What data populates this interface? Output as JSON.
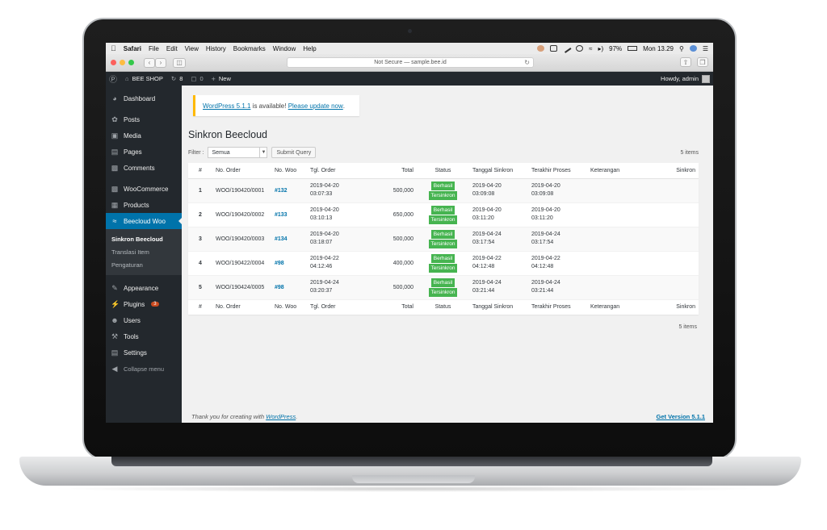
{
  "menubar": {
    "apple": "",
    "items": [
      "Safari",
      "File",
      "Edit",
      "View",
      "History",
      "Bookmarks",
      "Window",
      "Help"
    ],
    "battery": "97%",
    "clock": "Mon 13.29"
  },
  "browser": {
    "url": "Not Secure — sample.bee.id"
  },
  "adminbar": {
    "site": "BEE SHOP",
    "updates": "8",
    "comments": "0",
    "new_label": "New",
    "howdy": "Howdy, admin"
  },
  "sidebar": {
    "items": [
      {
        "label": "Dashboard",
        "icon": "dashboard-icon"
      },
      {
        "label": "Posts",
        "icon": "pin-icon"
      },
      {
        "label": "Media",
        "icon": "media-icon"
      },
      {
        "label": "Pages",
        "icon": "pages-icon"
      },
      {
        "label": "Comments",
        "icon": "comment-icon"
      },
      {
        "label": "WooCommerce",
        "icon": "woocommerce-icon"
      },
      {
        "label": "Products",
        "icon": "archive-icon"
      },
      {
        "label": "Beecloud Woo",
        "icon": "wifi-icon"
      },
      {
        "label": "Appearance",
        "icon": "brush-icon"
      },
      {
        "label": "Plugins",
        "icon": "plugin-icon",
        "badge": "3"
      },
      {
        "label": "Users",
        "icon": "users-icon"
      },
      {
        "label": "Tools",
        "icon": "wrench-icon"
      },
      {
        "label": "Settings",
        "icon": "settings-icon"
      }
    ],
    "submenu": [
      "Sinkron Beecloud",
      "Translasi Item",
      "Pengaturan"
    ],
    "collapse": "Collapse menu"
  },
  "notice": {
    "link": "WordPress 5.1.1",
    "text": " is available! ",
    "action": "Please update now",
    "period": "."
  },
  "page": {
    "title": "Sinkron Beecloud",
    "filter_label": "Filter :",
    "filter_value": "Semua",
    "submit": "Submit Query",
    "items_count": "5 items"
  },
  "table": {
    "headers": [
      "#",
      "No. Order",
      "No. Woo",
      "Tgl. Order",
      "Total",
      "Status",
      "Tanggal Sinkron",
      "Terakhir Proses",
      "Keterangan",
      "Sinkron"
    ],
    "rows": [
      {
        "num": "1",
        "order": "WOO/190420/0001",
        "woo": "#132",
        "tgl_d": "2019-04-20",
        "tgl_t": "03:07:33",
        "total": "500,000",
        "status1": "Berhasil",
        "status2": "Tersinkron",
        "sync_d": "2019-04-20",
        "sync_t": "03:09:08",
        "last_d": "2019-04-20",
        "last_t": "03:09:08",
        "note": "",
        "sinkron": ""
      },
      {
        "num": "2",
        "order": "WOO/190420/0002",
        "woo": "#133",
        "tgl_d": "2019-04-20",
        "tgl_t": "03:10:13",
        "total": "650,000",
        "status1": "Berhasil",
        "status2": "Tersinkron",
        "sync_d": "2019-04-20",
        "sync_t": "03:11:20",
        "last_d": "2019-04-20",
        "last_t": "03:11:20",
        "note": "",
        "sinkron": ""
      },
      {
        "num": "3",
        "order": "WOO/190420/0003",
        "woo": "#134",
        "tgl_d": "2019-04-20",
        "tgl_t": "03:18:07",
        "total": "500,000",
        "status1": "Berhasil",
        "status2": "Tersinkron",
        "sync_d": "2019-04-24",
        "sync_t": "03:17:54",
        "last_d": "2019-04-24",
        "last_t": "03:17:54",
        "note": "",
        "sinkron": ""
      },
      {
        "num": "4",
        "order": "WOO/190422/0004",
        "woo": "#98",
        "tgl_d": "2019-04-22",
        "tgl_t": "04:12:46",
        "total": "400,000",
        "status1": "Berhasil",
        "status2": "Tersinkron",
        "sync_d": "2019-04-22",
        "sync_t": "04:12:48",
        "last_d": "2019-04-22",
        "last_t": "04:12:48",
        "note": "",
        "sinkron": ""
      },
      {
        "num": "5",
        "order": "WOO/190424/0005",
        "woo": "#98",
        "tgl_d": "2019-04-24",
        "tgl_t": "03:20:37",
        "total": "500,000",
        "status1": "Berhasil",
        "status2": "Tersinkron",
        "sync_d": "2019-04-24",
        "sync_t": "03:21:44",
        "last_d": "2019-04-24",
        "last_t": "03:21:44",
        "note": "",
        "sinkron": ""
      }
    ]
  },
  "footer": {
    "text": "Thank you for creating with ",
    "link": "WordPress",
    "period": ".",
    "version": "Get Version 5.1.1"
  },
  "colors": {
    "sidebar_bg": "#23282d",
    "accent": "#0073aa",
    "success": "#46b450",
    "notice": "#ffb900"
  }
}
